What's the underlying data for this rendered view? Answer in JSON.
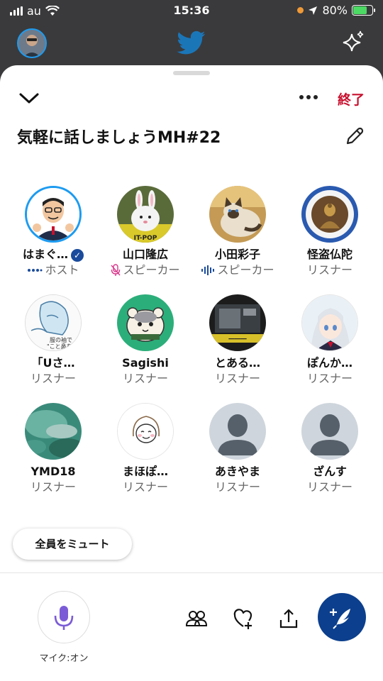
{
  "status_bar": {
    "carrier": "au",
    "time": "15:36",
    "battery": "80%",
    "battery_level": 0.8
  },
  "sheet": {
    "end_label": "終了",
    "title": "気軽に話しましょうMH#22"
  },
  "participants": [
    {
      "name": "はまぐ…",
      "role": "ホスト",
      "verified": true,
      "indicator": "host-dots",
      "avatar": "man-illustration"
    },
    {
      "name": "山口隆広",
      "role": "スピーカー",
      "indicator": "mic-muted",
      "avatar": "rabbit-toy"
    },
    {
      "name": "小田彩子",
      "role": "スピーカー",
      "indicator": "speaking-waves",
      "avatar": "siamese-cat"
    },
    {
      "name": "怪盗仏陀",
      "role": "リスナー",
      "avatar": "buddha-badge"
    },
    {
      "name": "「Uさ…",
      "role": "リスナー",
      "avatar": "sketch-drawing"
    },
    {
      "name": "Sagishi",
      "role": "リスナー",
      "avatar": "hamster-cartoon"
    },
    {
      "name": "とある…",
      "role": "リスナー",
      "avatar": "machine-photo"
    },
    {
      "name": "ぽんか…",
      "role": "リスナー",
      "avatar": "anime-girl"
    },
    {
      "name": "YMD18",
      "role": "リスナー",
      "avatar": "underwater"
    },
    {
      "name": "まほぽ…",
      "role": "リスナー",
      "avatar": "face-doodle"
    },
    {
      "name": "あきやま",
      "role": "リスナー",
      "avatar": "default-person"
    },
    {
      "name": "ざんす",
      "role": "リスナー",
      "avatar": "default-person"
    }
  ],
  "mute_all_label": "全員をミュート",
  "bottom_bar": {
    "mic_label": "マイク:オン"
  },
  "colors": {
    "accent_red": "#c8102e",
    "brand_blue": "#1d9bf0",
    "tweet_button": "#0c3f8d",
    "mic_purple": "#7b5cd6"
  }
}
